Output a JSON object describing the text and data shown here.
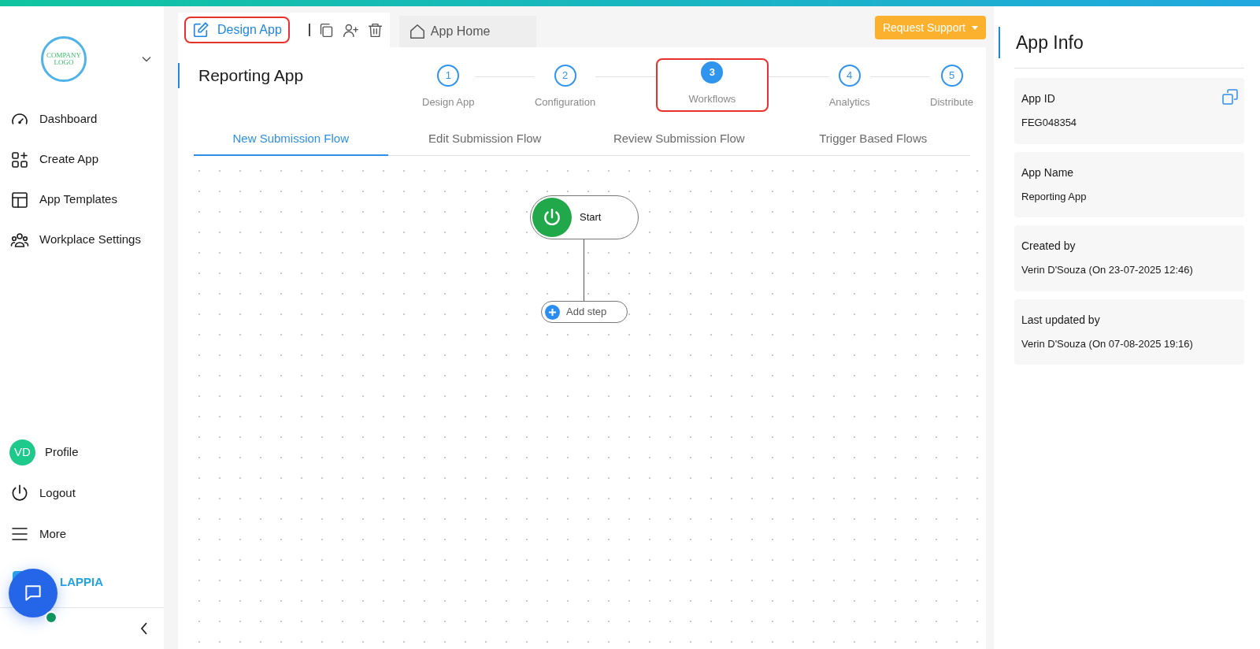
{
  "sidebar": {
    "logo_text": [
      "COMPANY",
      "LOGO"
    ],
    "items": [
      {
        "label": "Dashboard",
        "kind": "dashboard"
      },
      {
        "label": "Create App",
        "kind": "create"
      },
      {
        "label": "App Templates",
        "kind": "templates"
      },
      {
        "label": "Workplace Settings",
        "kind": "people"
      }
    ],
    "bottom_items": [
      {
        "label": "Profile",
        "kind": "avatar",
        "initials": "VD"
      },
      {
        "label": "Logout",
        "kind": "power"
      },
      {
        "label": "More",
        "kind": "menu"
      }
    ],
    "brand": "LAPPIA"
  },
  "toolbar": {
    "design_button": {
      "label": "Design App",
      "highlighted": true
    },
    "home_tab": "App Home",
    "support_button": "Request Support"
  },
  "page_title": "Reporting App",
  "steps": [
    {
      "number": "1",
      "label": "Design App",
      "selected": false,
      "highlighted": false
    },
    {
      "number": "2",
      "label": "Configuration",
      "selected": false,
      "highlighted": false
    },
    {
      "number": "3",
      "label": "Workflows",
      "selected": true,
      "highlighted": true
    },
    {
      "number": "4",
      "label": "Analytics",
      "selected": false,
      "highlighted": false
    },
    {
      "number": "5",
      "label": "Distribute",
      "selected": false,
      "highlighted": false
    }
  ],
  "tabs": [
    {
      "label": "New Submission Flow",
      "selected": true
    },
    {
      "label": "Edit Submission Flow",
      "selected": false
    },
    {
      "label": "Review Submission Flow",
      "selected": false
    },
    {
      "label": "Trigger Based Flows",
      "selected": false
    }
  ],
  "workflow": {
    "start": "Start",
    "add_step": "Add step"
  },
  "app_info": {
    "title": "App Info",
    "fields": [
      {
        "label": "App ID",
        "value": "FEG048354",
        "copyable": true
      },
      {
        "label": "App Name",
        "value": "Reporting App",
        "copyable": false
      },
      {
        "label": "Created by",
        "value": "Verin D'Souza (On 23-07-2025 12:46)",
        "copyable": false
      },
      {
        "label": "Last updated by",
        "value": "Verin D'Souza (On 07-08-2025 19:16)",
        "copyable": false
      }
    ]
  }
}
